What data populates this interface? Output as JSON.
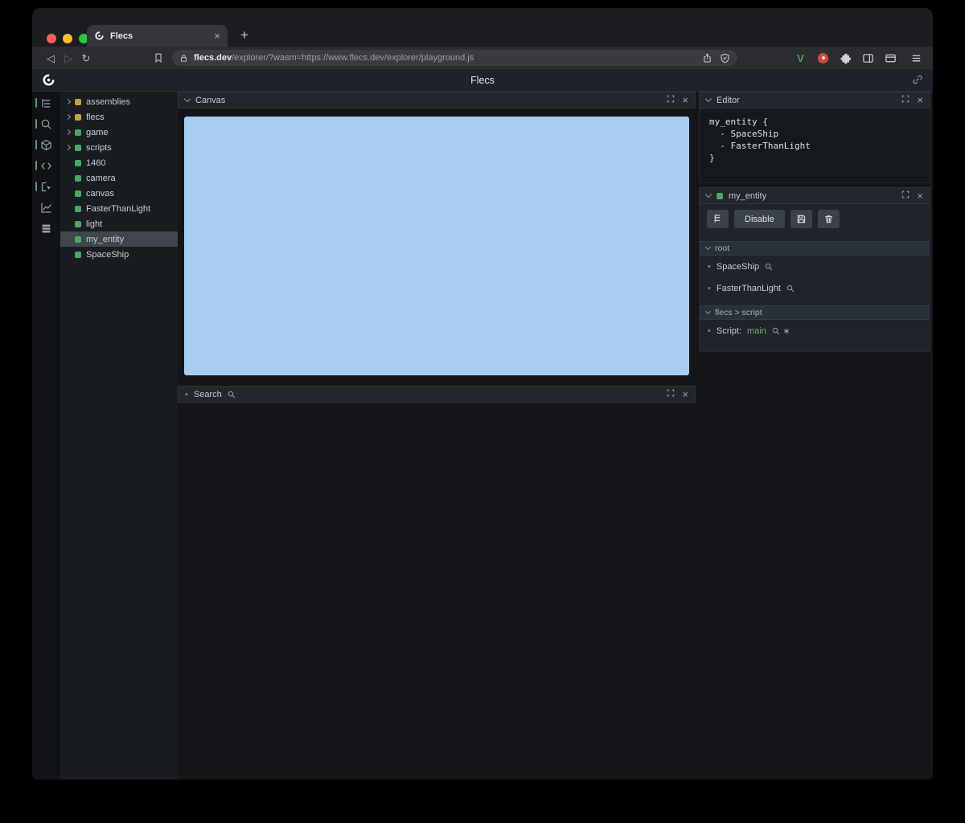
{
  "browser": {
    "tab_title": "Flecs",
    "new_tab_label": "+",
    "url_prefix": "flecs.dev",
    "url_rest": "/explorer/?wasm=https://www.flecs.dev/explorer/playground.js"
  },
  "app": {
    "title": "Flecs"
  },
  "activity_bar": {
    "icons": [
      "tree-view",
      "search",
      "entities-cube",
      "code",
      "inspect",
      "stats",
      "rows"
    ]
  },
  "tree": {
    "items": [
      {
        "label": "assemblies",
        "color": "yellow",
        "expandable": true,
        "selected": false
      },
      {
        "label": "flecs",
        "color": "yellow",
        "expandable": true,
        "selected": false
      },
      {
        "label": "game",
        "color": "green",
        "expandable": true,
        "selected": false
      },
      {
        "label": "scripts",
        "color": "green",
        "expandable": true,
        "selected": false
      },
      {
        "label": "1460",
        "color": "green",
        "expandable": false,
        "selected": false
      },
      {
        "label": "camera",
        "color": "green",
        "expandable": false,
        "selected": false
      },
      {
        "label": "canvas",
        "color": "green",
        "expandable": false,
        "selected": false
      },
      {
        "label": "FasterThanLight",
        "color": "green",
        "expandable": false,
        "selected": false
      },
      {
        "label": "light",
        "color": "green",
        "expandable": false,
        "selected": false
      },
      {
        "label": "my_entity",
        "color": "green",
        "expandable": false,
        "selected": true
      },
      {
        "label": "SpaceShip",
        "color": "green",
        "expandable": false,
        "selected": false
      }
    ]
  },
  "panels": {
    "canvas": {
      "title": "Canvas"
    },
    "search": {
      "title": "Search"
    },
    "editor": {
      "title": "Editor",
      "code": [
        "my_entity {",
        "  - SpaceShip",
        "  - FasterThanLight",
        "}"
      ]
    },
    "entity": {
      "title": "my_entity",
      "disable_label": "Disable",
      "sections": [
        {
          "title": "root",
          "items": [
            {
              "text": "SpaceShip"
            },
            {
              "text": "FasterThanLight"
            }
          ]
        },
        {
          "title": "flecs > script",
          "items": [
            {
              "text": "Script:",
              "value": "main",
              "star": true
            }
          ]
        }
      ]
    }
  },
  "colors": {
    "accent_green": "#4aa863",
    "accent_yellow": "#c2a23b",
    "canvas_blue": "#a6cdee",
    "code_green": "#62b562",
    "selected_row": "#41464d"
  }
}
